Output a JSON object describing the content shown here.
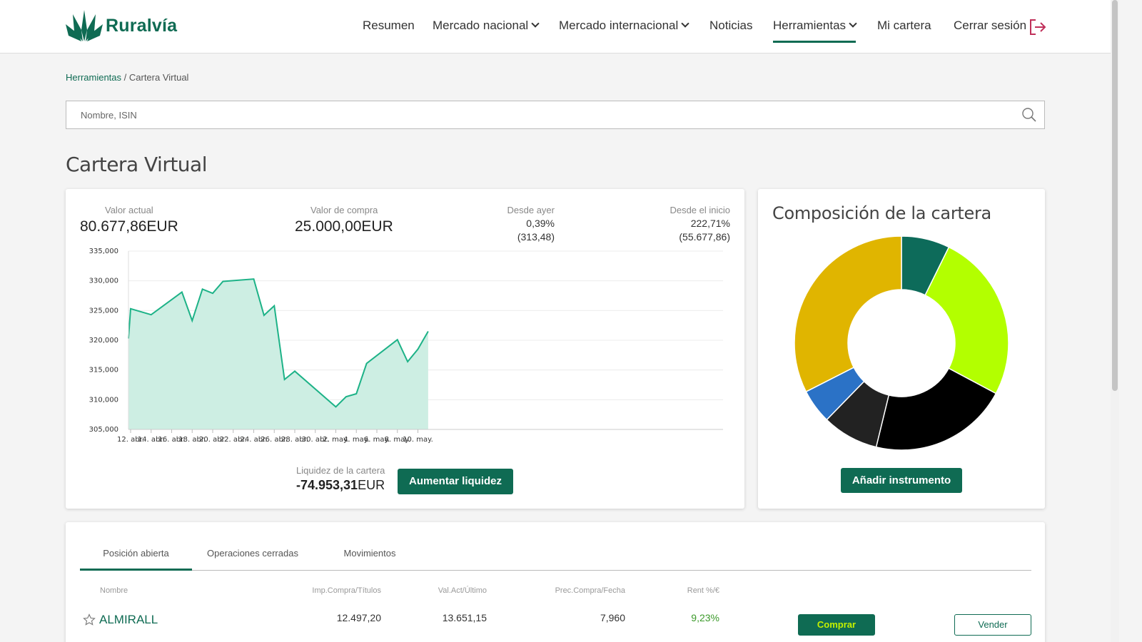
{
  "brand": {
    "name": "Ruralvía",
    "color": "#0f6b53"
  },
  "nav": {
    "items": [
      {
        "label": "Resumen",
        "has_dropdown": false
      },
      {
        "label": "Mercado nacional",
        "has_dropdown": true
      },
      {
        "label": "Mercado internacional",
        "has_dropdown": true
      },
      {
        "label": "Noticias",
        "has_dropdown": false
      },
      {
        "label": "Herramientas",
        "has_dropdown": true,
        "active": true
      },
      {
        "label": "Mi cartera",
        "has_dropdown": false
      },
      {
        "label": "Cerrar sesión",
        "has_dropdown": false
      }
    ],
    "logout_icon": "logout-icon"
  },
  "breadcrumb": {
    "parent": "Herramientas",
    "separator": " / ",
    "current": "Cartera Virtual"
  },
  "search": {
    "placeholder": "Nombre, ISIN",
    "value": "",
    "icon": "search-icon"
  },
  "page_title": "Cartera Virtual",
  "summary": {
    "valor_actual": {
      "label": "Valor actual",
      "value": "80.677,86EUR"
    },
    "valor_compra": {
      "label": "Valor de compra",
      "value": "25.000,00EUR"
    },
    "desde_ayer": {
      "label": "Desde ayer",
      "pct": "0,39%",
      "abs": "(313,48)"
    },
    "desde_inicio": {
      "label": "Desde el inicio",
      "pct": "222,71%",
      "abs": "(55.677,86)"
    }
  },
  "chart_data": {
    "type": "area",
    "y_ticks": [
      "335,000",
      "330,000",
      "325,000",
      "320,000",
      "315,000",
      "310,000",
      "305,000"
    ],
    "ylim": [
      305000,
      335000
    ],
    "x_ticks": [
      "12. abr.",
      "14. abr.",
      "16. abr.",
      "18. abr.",
      "20. abr.",
      "22. abr.",
      "24. abr.",
      "26. abr.",
      "28. abr.",
      "30. abr.",
      "2. may.",
      "4. may.",
      "6. may.",
      "8. may.",
      "10. may."
    ],
    "x": [
      "11. abr.",
      "12. abr.",
      "14. abr.",
      "17. abr.",
      "18. abr.",
      "19. abr.",
      "20. abr.",
      "21. abr.",
      "24. abr.",
      "25. abr.",
      "26. abr.",
      "27. abr.",
      "28. abr.",
      "2. may.",
      "3. may.",
      "4. may.",
      "5. may.",
      "8. may.",
      "9. may.",
      "10. may.",
      "11. may."
    ],
    "values": [
      320300,
      325300,
      324300,
      328100,
      323300,
      328600,
      327900,
      329900,
      330300,
      324200,
      325800,
      313400,
      314800,
      308800,
      310500,
      311000,
      316100,
      320100,
      316400,
      318500,
      321500
    ],
    "line_color": "#1db287",
    "fill_color": "#cdeee3"
  },
  "liquidez": {
    "label": "Liquidez de la cartera",
    "value": "-74.953,31",
    "unit": "EUR",
    "button": "Aumentar liquidez"
  },
  "composition": {
    "title": "Composición de la cartera",
    "button": "Añadir instrumento",
    "slices": [
      {
        "value": 7.3,
        "color": "#0d6b5a"
      },
      {
        "value": 25.5,
        "color": "#b3ff00"
      },
      {
        "value": 21.0,
        "color": "#000000"
      },
      {
        "value": 8.5,
        "color": "#222222"
      },
      {
        "value": 5.2,
        "color": "#2b72c6"
      },
      {
        "value": 32.5,
        "color": "#e0b500"
      }
    ]
  },
  "table": {
    "tabs": [
      {
        "label": "Posición abierta",
        "active": true
      },
      {
        "label": "Operaciones cerradas",
        "active": false
      },
      {
        "label": "Movimientos",
        "active": false
      }
    ],
    "columns": [
      "Nombre",
      "Imp.Compra/Títulos",
      "Val.Act/Último",
      "Prec.Compra/Fecha",
      "Rent %/€"
    ],
    "rows": [
      {
        "name": "ALMIRALL",
        "imp_compra": "12.497,20",
        "val_act": "13.651,15",
        "prec_compra": "7,960",
        "rent": "9,23%",
        "buy": "Comprar",
        "sell": "Vender"
      }
    ]
  }
}
